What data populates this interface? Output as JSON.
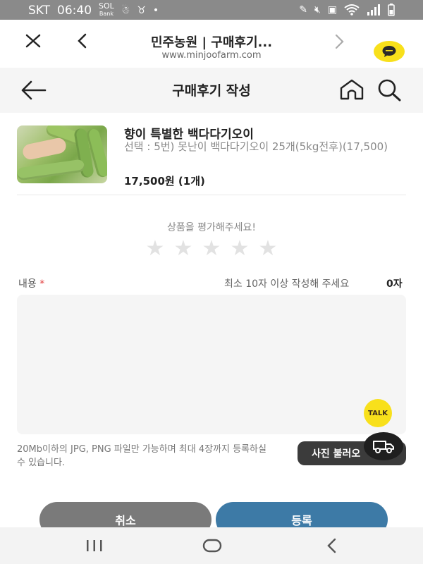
{
  "status_bar": {
    "carrier": "SKT",
    "time": "06:40",
    "bank_top": "SOL",
    "bank_bottom": "Bank",
    "icons": [
      "sol-bank-icon",
      "app-icon",
      "app-icon-2",
      "dot-icon",
      "pen-icon",
      "mute-icon",
      "photo-icon",
      "wifi-icon",
      "signal-icon",
      "battery-icon"
    ]
  },
  "browser": {
    "title": "민주농원 | 구매후기...",
    "url": "www.minjoofarm.com"
  },
  "page": {
    "title": "구매후기 작성"
  },
  "product": {
    "name": "향이 특별한 백다다기오이",
    "option": "선택 : 5번) 못난이 백다다기오이 25개(5kg전후)(17,500)",
    "price": "17,500원 (1개)"
  },
  "rating": {
    "label": "상품을 평가해주세요!",
    "stars": [
      0,
      0,
      0,
      0,
      0
    ],
    "max": 5
  },
  "content": {
    "label": "내용",
    "required_mark": "*",
    "hint": "최소 10자 이상 작성해 주세요",
    "count": "0자",
    "value": ""
  },
  "photo": {
    "note": "20Mb이하의 JPG, PNG 파일만 가능하며 최대 4장까지 등록하실 수 있습니다.",
    "button_label": "사진 불러오"
  },
  "floating": {
    "talk_label": "TALK"
  },
  "actions": {
    "cancel_label": "취소",
    "submit_label": "등록"
  },
  "colors": {
    "accent": "#3d7aa6",
    "cancel": "#7a7a7a",
    "kakao": "#f8e01b"
  }
}
